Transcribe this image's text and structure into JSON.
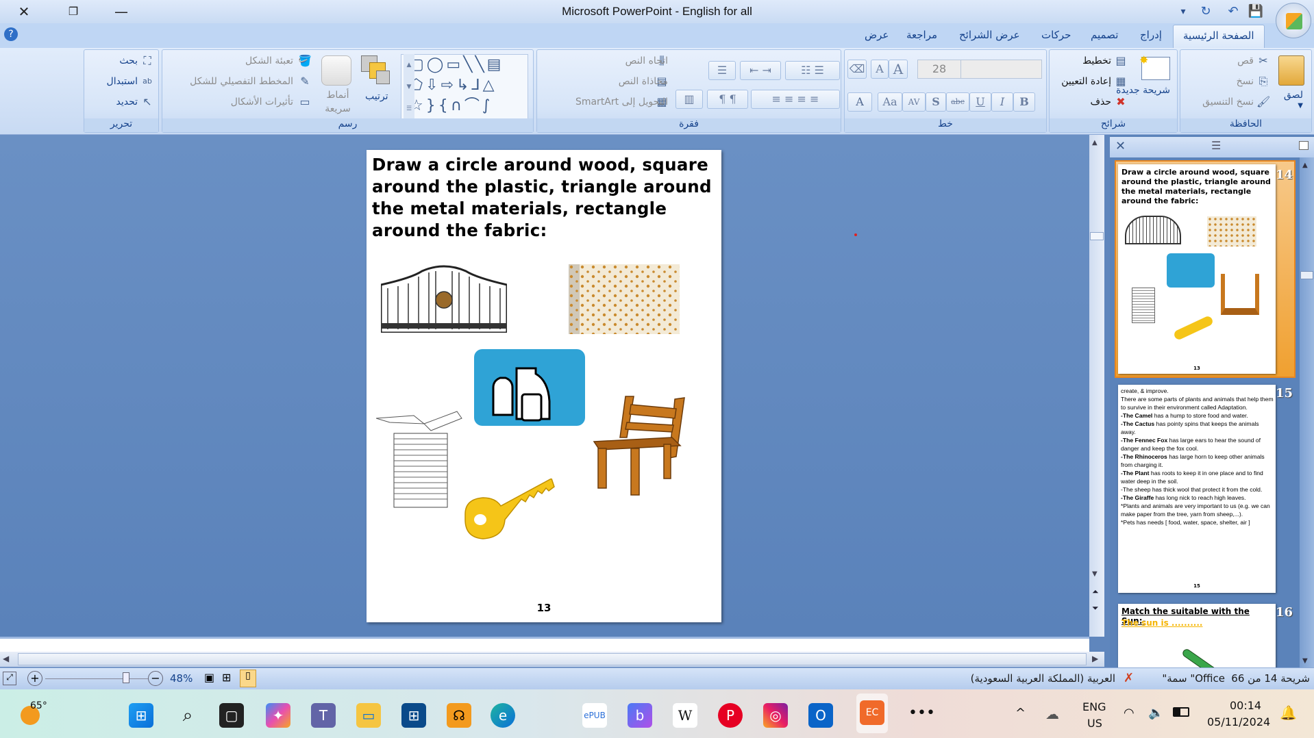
{
  "window": {
    "title": "Microsoft PowerPoint - English for all"
  },
  "tabs": [
    {
      "label": "الصفحة الرئيسية",
      "active": true
    },
    {
      "label": "إدراج"
    },
    {
      "label": "تصميم"
    },
    {
      "label": "حركات"
    },
    {
      "label": "عرض الشرائح"
    },
    {
      "label": "مراجعة"
    },
    {
      "label": "عرض"
    }
  ],
  "ribbon": {
    "clipboard": {
      "label": "الحافظة",
      "paste": "لصق",
      "cut": "قص",
      "copy": "نسخ",
      "format_painter": "نسخ التنسيق"
    },
    "slides": {
      "label": "شرائح",
      "new_slide": "شريحة جديدة",
      "layout": "تخطيط",
      "reset": "إعادة التعيين",
      "delete": "حذف"
    },
    "font": {
      "label": "خط",
      "font_name": "",
      "font_size": "28",
      "bold": "B",
      "italic": "I",
      "underline": "U",
      "strike": "abc",
      "shadow": "S",
      "spacing": "AV",
      "case": "Aa",
      "color": "A"
    },
    "paragraph": {
      "label": "فقرة",
      "text_direction": "اتجاه النص",
      "align_text": "محاذاة النص",
      "smartart": "التحويل إلى SmartArt"
    },
    "drawing": {
      "label": "رسم",
      "arrange": "ترتيب",
      "quick_styles": "أنماط سريعة",
      "shape_fill": "تعبئة الشكل",
      "shape_outline": "المخطط التفصيلي للشكل",
      "shape_effects": "تأثيرات الأشكال"
    },
    "editing": {
      "label": "تحرير",
      "find": "بحث",
      "replace": "استبدال",
      "select": "تحديد"
    }
  },
  "slide": {
    "question": "Draw a circle around wood, square around the plastic, triangle around the metal materials, rectangle around the fabric:",
    "page_number": "13"
  },
  "thumbnails": [
    {
      "number": "14",
      "selected": true,
      "title": "Draw a circle around wood, square around the plastic, triangle around the metal materials, rectangle around the fabric:",
      "page": "13"
    },
    {
      "number": "15",
      "lines": [
        "create, & improve.",
        "There are some parts of plants and animals that help them to survive in their environment called Adaptation.",
        "-The Camel has a hump to store food and water.",
        "-The Cactus has pointy spins that keeps the animals away.",
        "-The Fennec Fox has large ears to hear the sound of danger and keep the fox cool.",
        "-The Rhinoceros has large horn to keep other animals from charging it.",
        "-The Plant has roots to keep it in one place and to find water deep in the soil.",
        "-The sheep has thick wool that protect it from the cold.",
        "-The Giraffe has long nick to reach high leaves.",
        "*Plants and animals are very important to us (e.g. we can make paper from the tree, yarn from sheep,...).",
        "*Pets has needs [ food, water, space, shelter, air ]"
      ],
      "page": "15"
    },
    {
      "number": "16",
      "title": "Match the suitable with the Sun:-",
      "subtitle": "The sun is ..........",
      "subtitle_color": "#f5b400"
    }
  ],
  "statusbar": {
    "slide_info": "شريحة 14 من 66",
    "theme": "\"سمة \"Office",
    "language": "العربية (المملكة العربية السعودية)",
    "zoom": "48%",
    "zoom_percent": 48
  },
  "taskbar": {
    "weather": "65°",
    "language": "ENG",
    "region": "US",
    "time": "00:14",
    "date": "05/11/2024",
    "apps": [
      "start",
      "search",
      "task-view",
      "copilot",
      "teams",
      "file-explorer",
      "store",
      "app-orange",
      "edge",
      "epub",
      "bing",
      "wikipedia",
      "pinterest",
      "instagram",
      "outlook",
      "powerpoint",
      "more"
    ]
  },
  "colors": {
    "ribbon": "#d7e5f8",
    "tab_text": "#15428b",
    "workspace": "#5f86bd",
    "selected_thumb": "#f0a030",
    "plastic_bg": "#2fa3d6",
    "key": "#f5c518",
    "chair": "#c8781e"
  }
}
